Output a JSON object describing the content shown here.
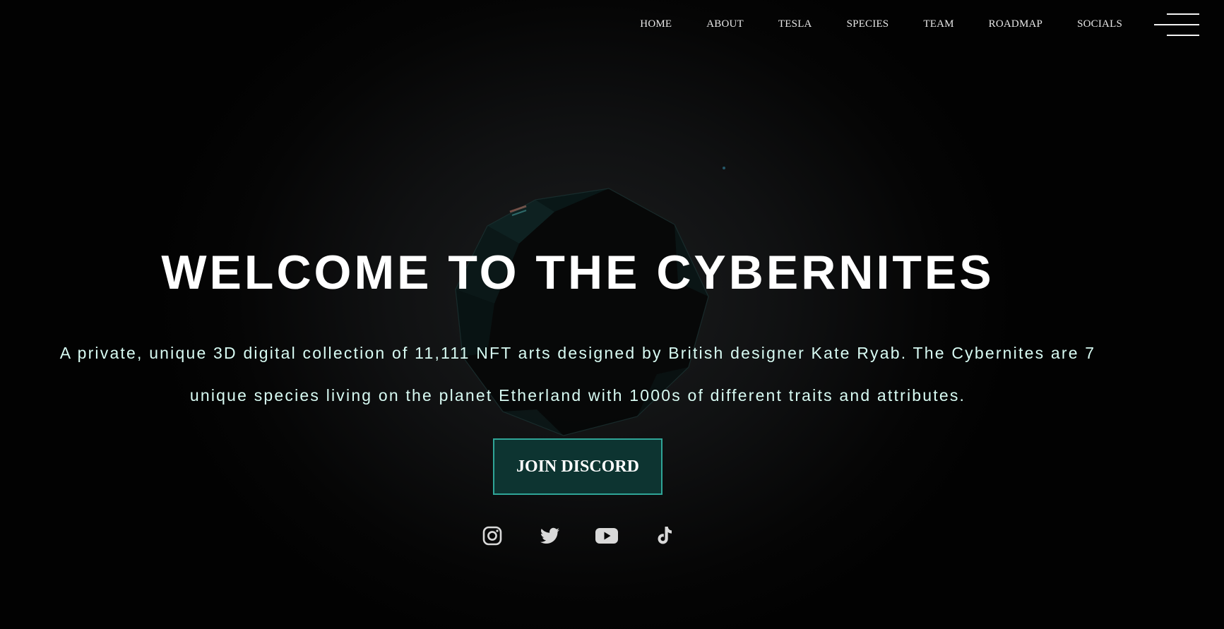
{
  "nav": {
    "items": [
      {
        "label": "HOME"
      },
      {
        "label": "ABOUT"
      },
      {
        "label": "TESLA"
      },
      {
        "label": "SPECIES"
      },
      {
        "label": "TEAM"
      },
      {
        "label": "ROADMAP"
      },
      {
        "label": "SOCIALS"
      }
    ],
    "menu_icon": "hamburger-menu-icon"
  },
  "hero": {
    "title": "WELCOME TO THE CYBERNITES",
    "description": "A private, unique 3D digital collection of 11,111 NFT arts designed by British designer Kate Ryab. The Cybernites are 7 unique species living on the planet Etherland with 1000s of different traits and attributes.",
    "cta_label": "JOIN DISCORD"
  },
  "socials": [
    {
      "icon": "instagram-icon"
    },
    {
      "icon": "twitter-icon"
    },
    {
      "icon": "youtube-icon"
    },
    {
      "icon": "tiktok-icon"
    }
  ],
  "colors": {
    "background": "#030303",
    "accent_border": "#2fa597",
    "cta_background": "#0d3431",
    "description_text": "#d8fbf3",
    "icon": "#d9d9d9"
  }
}
